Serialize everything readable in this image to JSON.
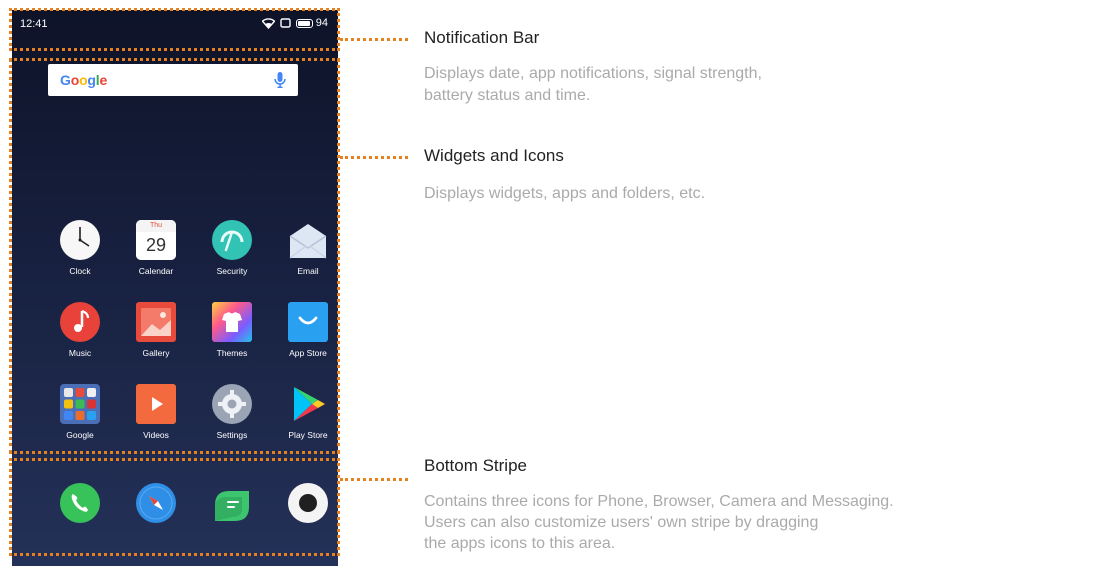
{
  "status_bar": {
    "time": "12:41",
    "battery": "94",
    "battery_level": 0.94
  },
  "search": {
    "logo": "Google"
  },
  "calendar_tile": {
    "weekday": "Thu",
    "day": "29"
  },
  "apps_row1": [
    {
      "label": "Clock",
      "icon": "clock-icon"
    },
    {
      "label": "Calendar",
      "icon": "calendar-icon"
    },
    {
      "label": "Security",
      "icon": "security-icon"
    },
    {
      "label": "Email",
      "icon": "email-icon"
    }
  ],
  "apps_row2": [
    {
      "label": "Music",
      "icon": "music-icon"
    },
    {
      "label": "Gallery",
      "icon": "gallery-icon"
    },
    {
      "label": "Themes",
      "icon": "themes-icon"
    },
    {
      "label": "App Store",
      "icon": "app-store-icon"
    }
  ],
  "apps_row3": [
    {
      "label": "Google",
      "icon": "folder-icon"
    },
    {
      "label": "Videos",
      "icon": "videos-icon"
    },
    {
      "label": "Settings",
      "icon": "settings-icon"
    },
    {
      "label": "Play Store",
      "icon": "play-store-icon"
    }
  ],
  "dock": [
    {
      "icon": "phone-icon"
    },
    {
      "icon": "browser-icon"
    },
    {
      "icon": "messaging-icon"
    },
    {
      "icon": "camera-icon"
    }
  ],
  "annotations": {
    "notification_bar": {
      "title": "Notification Bar",
      "line1": "Displays date, app notifications, signal strength,",
      "line2": "battery status and time."
    },
    "widgets": {
      "title": "Widgets and Icons",
      "line1": "Displays widgets, apps and folders, etc."
    },
    "bottom_stripe": {
      "title": "Bottom Stripe",
      "line1": "Contains three icons for Phone, Browser, Camera and Messaging.",
      "line2": "Users can also customize users' own stripe by dragging",
      "line3": "the apps icons to this area."
    }
  },
  "colors": {
    "accent_dotted": "#e5811e",
    "title_text": "#222222",
    "desc_text": "#aaaaaa"
  }
}
